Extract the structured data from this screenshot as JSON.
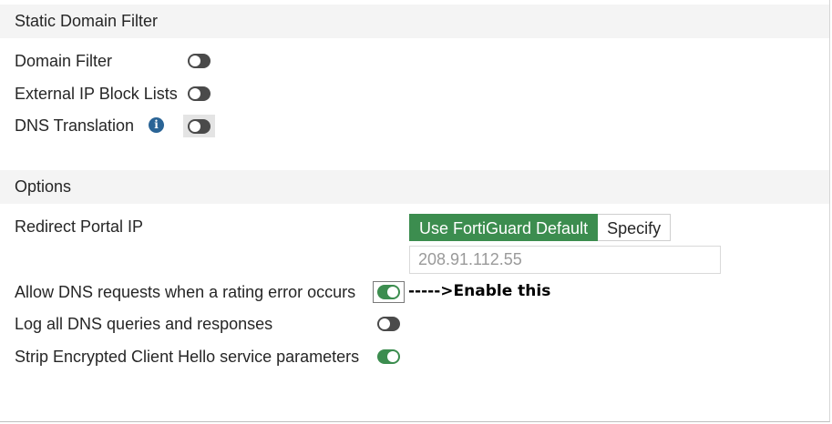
{
  "static_domain_filter": {
    "header": "Static Domain Filter",
    "domain_filter": {
      "label": "Domain Filter",
      "enabled": false
    },
    "external_ip_block_lists": {
      "label": "External IP Block Lists",
      "enabled": false
    },
    "dns_translation": {
      "label": "DNS Translation",
      "enabled": false,
      "info_icon": "info-icon"
    }
  },
  "options": {
    "header": "Options",
    "redirect_portal_ip": {
      "label": "Redirect Portal IP",
      "mode_options": [
        "Use FortiGuard Default",
        "Specify"
      ],
      "selected": "Use FortiGuard Default",
      "ip_value": "208.91.112.55"
    },
    "allow_dns_on_rating_error": {
      "label": "Allow DNS requests when a rating error occurs",
      "enabled": true
    },
    "log_all_dns": {
      "label": "Log all DNS queries and responses",
      "enabled": false
    },
    "strip_ech": {
      "label": "Strip Encrypted Client Hello service parameters",
      "enabled": true
    }
  },
  "annotation": "----->Enable this",
  "colors": {
    "accent_green": "#3c8d4f",
    "toggle_off": "#4a4a4a",
    "header_bg": "#f4f4f4",
    "info_blue": "#2a6496"
  }
}
